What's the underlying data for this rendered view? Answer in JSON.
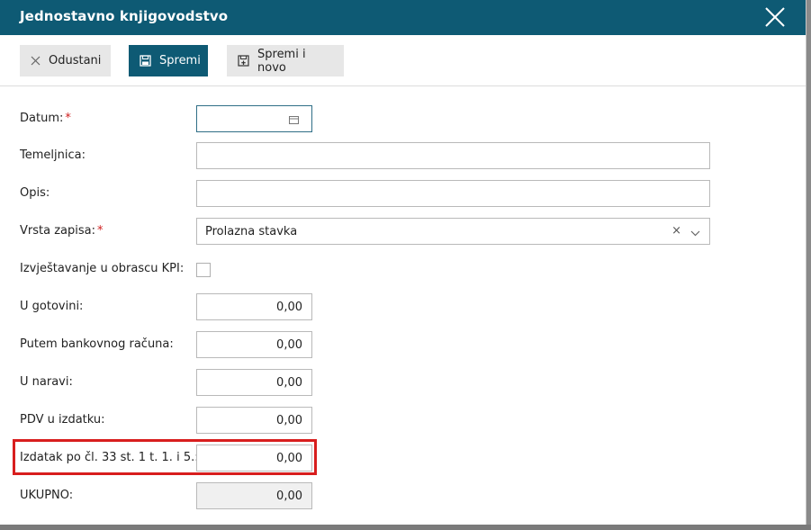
{
  "modal": {
    "title": "Jednostavno knjigovodstvo"
  },
  "toolbar": {
    "cancel_label": "Odustani",
    "save_label": "Spremi",
    "save_new_label": "Spremi i novo"
  },
  "form": {
    "datum": {
      "label": "Datum:",
      "required": "*",
      "value": ""
    },
    "temeljnica": {
      "label": "Temeljnica:",
      "value": ""
    },
    "opis": {
      "label": "Opis:",
      "value": ""
    },
    "vrsta_zapisa": {
      "label": "Vrsta zapisa:",
      "required": "*",
      "value": "Prolazna stavka",
      "clear": "×"
    },
    "kpi": {
      "label": "Izvještavanje u obrascu KPI:",
      "checked": false
    },
    "u_gotovini": {
      "label": "U gotovini:",
      "value": "0,00"
    },
    "putem_banke": {
      "label": "Putem bankovnog računa:",
      "value": "0,00"
    },
    "u_naravi": {
      "label": "U naravi:",
      "value": "0,00"
    },
    "pdv": {
      "label": "PDV u izdatku:",
      "value": "0,00"
    },
    "izdatak": {
      "label": "Izdatak po čl. 33 st. 1 t. 1. i 5.:",
      "value": "0,00"
    },
    "ukupno": {
      "label": "UKUPNO:",
      "value": "0,00"
    }
  },
  "colors": {
    "header": "#0e5a74",
    "highlight": "#d81e1e",
    "required": "#d02020"
  }
}
